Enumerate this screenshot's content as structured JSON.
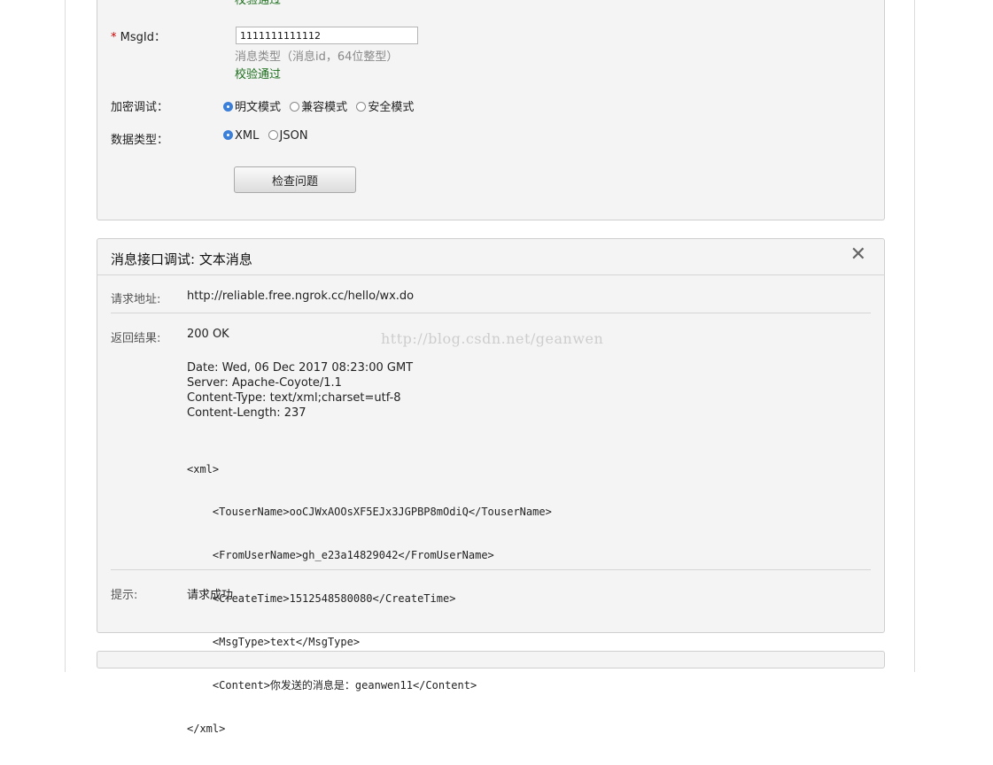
{
  "form": {
    "prev_validation": "校验通过",
    "msgid": {
      "label": "MsgId：",
      "required_mark": "*",
      "value": "1111111111112",
      "hint": "消息类型（消息id，64位整型）",
      "validation": "校验通过"
    },
    "encryption": {
      "label": "加密调试：",
      "options": [
        {
          "label": "明文模式",
          "selected": true
        },
        {
          "label": "兼容模式",
          "selected": false
        },
        {
          "label": "安全模式",
          "selected": false
        }
      ]
    },
    "data_type": {
      "label": "数据类型：",
      "options": [
        {
          "label": "XML",
          "selected": true
        },
        {
          "label": "JSON",
          "selected": false
        }
      ]
    },
    "check_button_label": "检查问题"
  },
  "result": {
    "title": "消息接口调试: 文本消息",
    "close_symbol": "✕",
    "request_url_label": "请求地址:",
    "request_url": "http://reliable.free.ngrok.cc/hello/wx.do",
    "response_label": "返回结果:",
    "status": "200 OK",
    "headers": [
      "Date: Wed, 06 Dec 2017 08:23:00 GMT",
      "Server: Apache-Coyote/1.1",
      "Content-Type: text/xml;charset=utf-8",
      "Content-Length: 237"
    ],
    "xml_lines": [
      "<xml>",
      "    <TouserName>ooCJWxAOOsXF5EJx3JGPBP8mOdiQ</TouserName>",
      "    <FromUserName>gh_e23a14829042</FromUserName>",
      "    <CreateTime>1512548580080</CreateTime>",
      "    <MsgType>text</MsgType>",
      "    <Content>你发送的消息是：geanwen11</Content>",
      "</xml>"
    ],
    "watermark": "http://blog.csdn.net/geanwen",
    "tip_label": "提示:",
    "tip_value": "请求成功"
  }
}
